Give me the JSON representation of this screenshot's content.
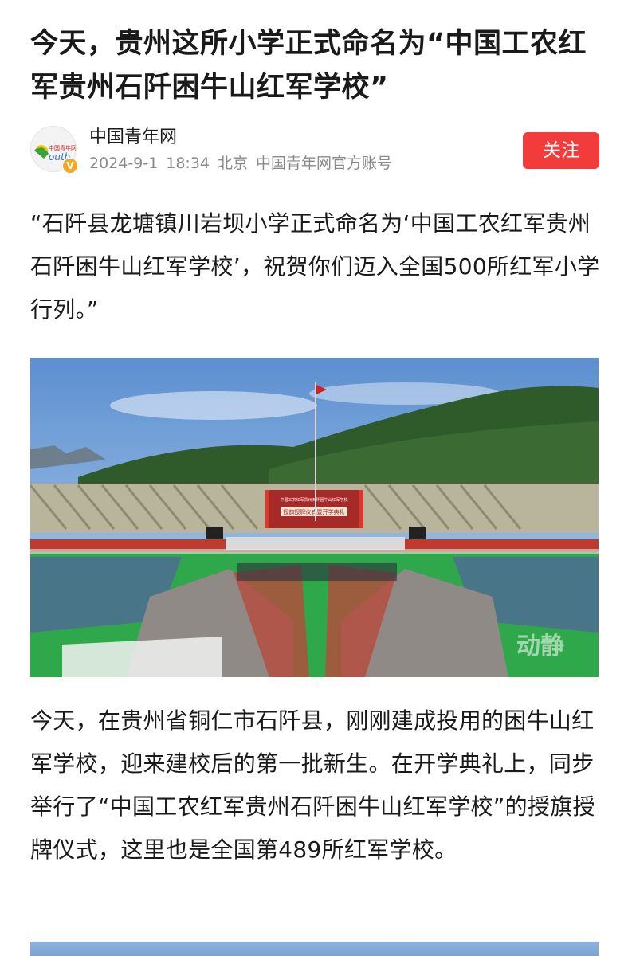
{
  "article": {
    "title": "今天，贵州这所小学正式命名为“中国工农红军贵州石阡困牛山红军学校”",
    "author": {
      "name": "中国青年网",
      "avatar_logo_text": "中国青年网",
      "avatar_logo_text2": "outh",
      "verified_badge": "V",
      "date": "2024-9-1",
      "time": "18:34",
      "location": "北京",
      "account_type": "中国青年网官方账号"
    },
    "follow_label": "关注",
    "quote": "“石阡县龙塘镇川岩坝小学正式命名为‘中国工农红军贵州石阡困牛山红军学校’，祝贺你们迈入全国500所红军小学行列。”",
    "photo": {
      "banner_line1": "中国工农红军贵州石阡困牛山红军学校",
      "banner_line2": "授旗授牌仪式暨开学典礼",
      "watermark": "动静"
    },
    "paragraph": "今天，在贵州省铜仁市石阡县，刚刚建成投用的困牛山红军学校，迎来建校后的第一批新生。在开学典礼上，同步举行了“中国工农红军贵州石阡困牛山红军学校”的授旗授牌仪式，这里也是全国第489所红军学校。"
  }
}
